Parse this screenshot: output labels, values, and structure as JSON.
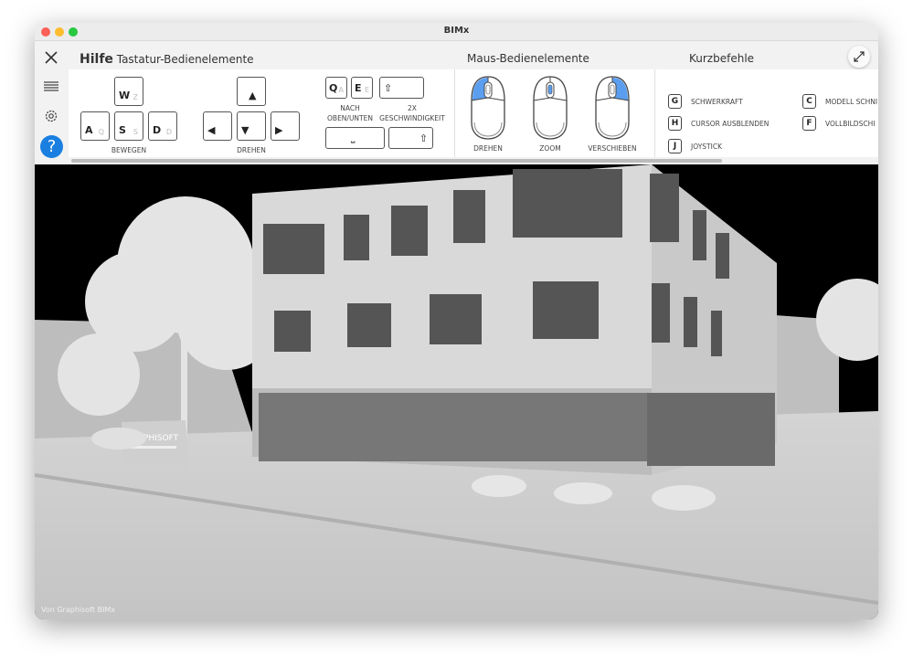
{
  "window": {
    "title": "BIMx"
  },
  "panel": {
    "title": "Hilfe",
    "keyboard_heading": "Tastatur-Bedienelemente",
    "mouse_heading": "Maus-Bedienelemente",
    "shortcuts_heading": "Kurzbefehle",
    "move": {
      "label": "BEWEGEN",
      "keys": [
        {
          "main": "W",
          "alt": "Z"
        },
        {
          "main": "A",
          "alt": "Q"
        },
        {
          "main": "S",
          "alt": "S"
        },
        {
          "main": "D",
          "alt": "D"
        }
      ]
    },
    "rotate": {
      "label": "DREHEN",
      "keys": [
        "▲",
        "◀",
        "▼",
        "▶"
      ]
    },
    "updown": {
      "label1": "NACH",
      "label2": "OBEN/UNTEN",
      "keys": [
        {
          "main": "Q",
          "alt": "A"
        },
        {
          "main": "E",
          "alt": "E"
        }
      ],
      "space": "⎵"
    },
    "speed": {
      "label1": "2X",
      "label2": "GESCHWINDIGKEIT",
      "shift": "⇧"
    },
    "mouse": [
      {
        "label": "DREHEN"
      },
      {
        "label": "ZOOM"
      },
      {
        "label": "VERSCHIEBEN"
      }
    ],
    "shortcuts": [
      {
        "key": "G",
        "label": "SCHWERKRAFT"
      },
      {
        "key": "H",
        "label": "CURSOR AUSBLENDEN"
      },
      {
        "key": "J",
        "label": "JOYSTICK"
      },
      {
        "key": "C",
        "label": "MODELL SCHNI"
      },
      {
        "key": "F",
        "label": "VOLLBILDSCHI"
      }
    ]
  },
  "sidebar": {
    "icons": [
      "close-icon",
      "list-icon",
      "gear-icon",
      "help-icon"
    ]
  },
  "colors": {
    "accent": "#5b9ef0",
    "help": "#1a7fe0"
  },
  "viewport": {
    "sign": "GRAPHISOFT",
    "credit": "Von Graphisoft BIMx"
  }
}
